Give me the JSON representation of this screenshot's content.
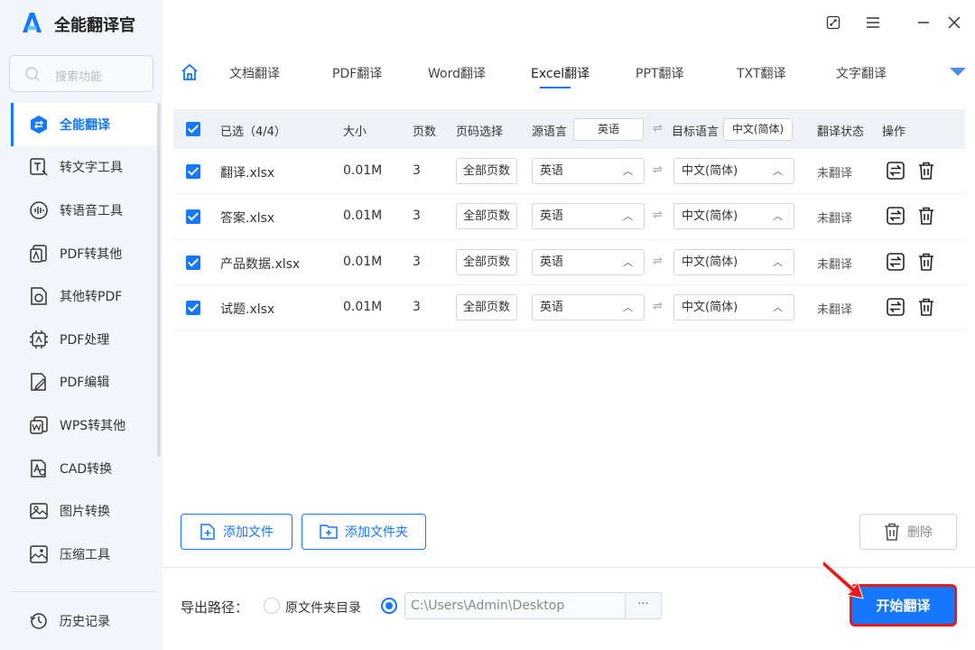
{
  "app": {
    "title": "全能翻译官"
  },
  "search": {
    "placeholder": "搜索功能"
  },
  "sidebar": {
    "items": [
      {
        "label": "全能翻译",
        "icon": "translate-icon"
      },
      {
        "label": "转文字工具",
        "icon": "text-convert-icon"
      },
      {
        "label": "转语音工具",
        "icon": "voice-icon"
      },
      {
        "label": "PDF转其他",
        "icon": "pdf-export-icon"
      },
      {
        "label": "其他转PDF",
        "icon": "pdf-import-icon"
      },
      {
        "label": "PDF处理",
        "icon": "pdf-process-icon"
      },
      {
        "label": "PDF编辑",
        "icon": "pdf-edit-icon"
      },
      {
        "label": "WPS转其他",
        "icon": "wps-icon"
      },
      {
        "label": "CAD转换",
        "icon": "cad-icon"
      },
      {
        "label": "图片转换",
        "icon": "image-icon"
      },
      {
        "label": "压缩工具",
        "icon": "compress-icon"
      }
    ],
    "history": "历史记录"
  },
  "tabs": [
    "文档翻译",
    "PDF翻译",
    "Word翻译",
    "Excel翻译",
    "PPT翻译",
    "TXT翻译",
    "文字翻译"
  ],
  "active_tab": "Excel翻译",
  "table": {
    "headers": {
      "selected": "已选（4/4）",
      "size": "大小",
      "pages": "页数",
      "page_select": "页码选择",
      "source_lang": "源语言",
      "source_lang_value": "英语",
      "target_lang": "目标语言",
      "target_lang_value": "中文(简体)",
      "status": "翻译状态",
      "action": "操作"
    },
    "rows": [
      {
        "name": "翻译.xlsx",
        "size": "0.01M",
        "pages": "3",
        "page_select": "全部页数",
        "source": "英语",
        "target": "中文(简体)",
        "status": "未翻译"
      },
      {
        "name": "答案.xlsx",
        "size": "0.01M",
        "pages": "3",
        "page_select": "全部页数",
        "source": "英语",
        "target": "中文(简体)",
        "status": "未翻译"
      },
      {
        "name": "产品数据.xlsx",
        "size": "0.01M",
        "pages": "3",
        "page_select": "全部页数",
        "source": "英语",
        "target": "中文(简体)",
        "status": "未翻译"
      },
      {
        "name": "试题.xlsx",
        "size": "0.01M",
        "pages": "3",
        "page_select": "全部页数",
        "source": "英语",
        "target": "中文(简体)",
        "status": "未翻译"
      }
    ]
  },
  "buttons": {
    "add_file": "添加文件",
    "add_folder": "添加文件夹",
    "delete": "删除",
    "start": "开始翻译"
  },
  "export": {
    "label": "导出路径：",
    "option_original": "原文件夹目录",
    "path": "C:\\Users\\Admin\\Desktop",
    "browse": "···"
  },
  "colors": {
    "accent": "#1677ff",
    "highlight_border": "#e81a1a"
  }
}
